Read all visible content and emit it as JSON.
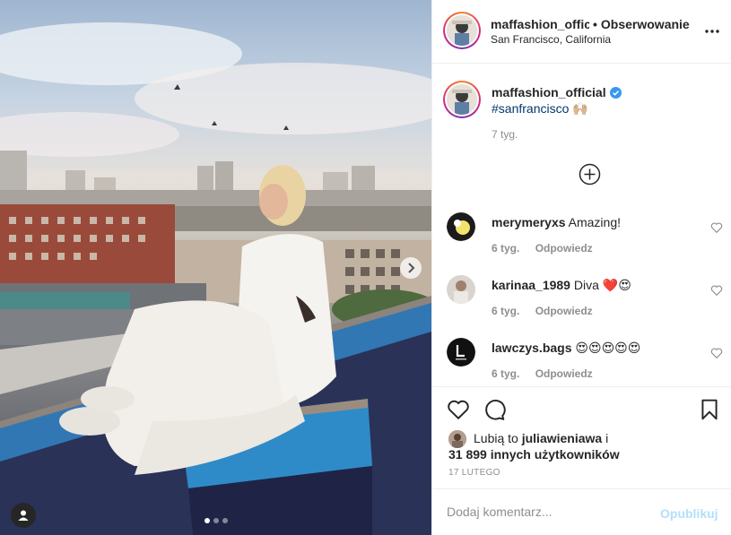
{
  "post": {
    "header": {
      "username": "maffashion_offici",
      "separator": "•",
      "follow_label": "Obserwowanie",
      "location": "San Francisco, California",
      "more_icon": "more-horizontal-icon"
    },
    "caption": {
      "username": "maffashion_official",
      "verified_icon": "verified-badge-icon",
      "hashtag": "#sanfrancisco",
      "emoji": "🙌🏼",
      "time": "7 tyg."
    },
    "load_more_icon": "plus-circle-icon",
    "comments": [
      {
        "username": "merymeryxs",
        "text": "Amazing!",
        "time": "6 tyg.",
        "reply_label": "Odpowiedz"
      },
      {
        "username": "karinaa_1989",
        "text": "Diva ❤️😍",
        "time": "6 tyg.",
        "reply_label": "Odpowiedz"
      },
      {
        "username": "lawczys.bags",
        "text": "😍😍😍😍😍",
        "time": "6 tyg.",
        "reply_label": "Odpowiedz"
      }
    ],
    "actions": {
      "like_icon": "heart-icon",
      "comment_icon": "comment-bubble-icon",
      "save_icon": "bookmark-icon"
    },
    "likes": {
      "prefix": "Lubią to",
      "user": "juliawieniawa",
      "conjunction": "i",
      "count_text": "31 899 innych użytkowników"
    },
    "date": "17 lutego",
    "add_comment": {
      "placeholder": "Dodaj komentarz...",
      "publish_label": "Opublikuj"
    },
    "carousel": {
      "active_index": 0,
      "total": 3,
      "next_icon": "chevron-right-icon",
      "tag_icon": "user-tag-icon"
    },
    "colors": {
      "link_blue": "#00376b",
      "verified_blue": "#3897f0",
      "publish_disabled": "#b2dffc",
      "muted_text": "#8e8e8e",
      "like_red": "#ed4956"
    }
  }
}
